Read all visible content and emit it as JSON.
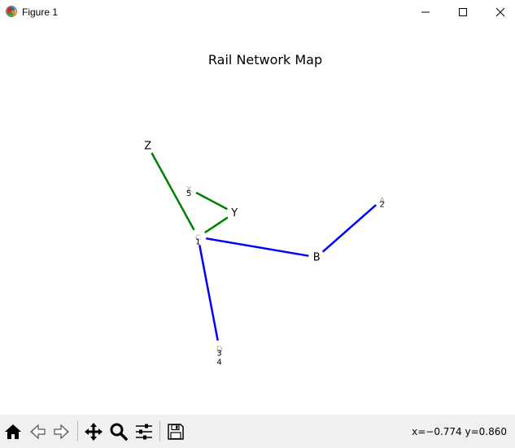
{
  "window": {
    "title": "Figure 1"
  },
  "figure": {
    "title": "Rail Network Map"
  },
  "chart_data": {
    "type": "network",
    "title": "Rail Network Map",
    "nodes": [
      {
        "id": "Z",
        "label": "Z",
        "x": -0.82,
        "y": 0.84
      },
      {
        "id": "X",
        "label": "X",
        "x": -0.55,
        "y": 0.52,
        "badge": "5"
      },
      {
        "id": "Y",
        "label": "Y",
        "x": -0.25,
        "y": 0.34
      },
      {
        "id": "A",
        "label": "A",
        "x": 0.72,
        "y": 0.44,
        "badge": "2"
      },
      {
        "id": "C",
        "label": "C",
        "x": -0.49,
        "y": 0.16,
        "badge": "1"
      },
      {
        "id": "B",
        "label": "B",
        "x": 0.29,
        "y": 0.01
      },
      {
        "id": "D",
        "label": "D",
        "x": -0.35,
        "y": -0.67,
        "badge": "3",
        "badge2": "4"
      }
    ],
    "edges": [
      {
        "from": "Z",
        "to": "C",
        "color": "#008000"
      },
      {
        "from": "X",
        "to": "Y",
        "color": "#008000"
      },
      {
        "from": "C",
        "to": "Y",
        "color": "#008000"
      },
      {
        "from": "C",
        "to": "B",
        "color": "#0000ff"
      },
      {
        "from": "B",
        "to": "A",
        "color": "#0000ff"
      },
      {
        "from": "C",
        "to": "D",
        "color": "#0000ff"
      }
    ]
  },
  "toolbar": {
    "buttons": [
      {
        "name": "home-button",
        "icon": "home-icon"
      },
      {
        "name": "back-button",
        "icon": "back-arrow-icon"
      },
      {
        "name": "forward-button",
        "icon": "forward-arrow-icon"
      },
      {
        "name": "pan-button",
        "icon": "move-icon"
      },
      {
        "name": "zoom-button",
        "icon": "magnifier-icon"
      },
      {
        "name": "configure-button",
        "icon": "sliders-icon"
      },
      {
        "name": "save-button",
        "icon": "floppy-icon"
      }
    ],
    "coords_text": "x=−0.774 y=0.860"
  }
}
